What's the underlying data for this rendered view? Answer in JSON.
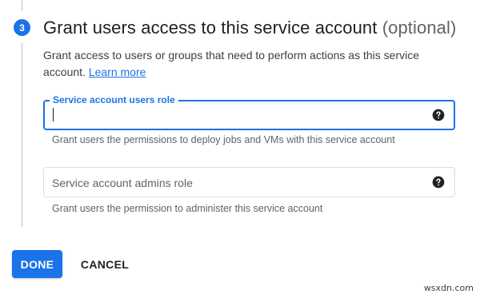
{
  "step": {
    "number": "3",
    "title": "Grant users access to this service account",
    "title_suffix": "(optional)",
    "description": "Grant access to users or groups that need to perform actions as this service account.",
    "learn_more": "Learn more"
  },
  "fields": {
    "users_role": {
      "label": "Service account users role",
      "value": "",
      "hint": "Grant users the permissions to deploy jobs and VMs with this service account",
      "help_icon": "help-circle-icon"
    },
    "admins_role": {
      "label": "Service account admins role",
      "value": "",
      "hint": "Grant users the permission to administer this service account",
      "help_icon": "help-circle-icon"
    }
  },
  "actions": {
    "done_label": "DONE",
    "cancel_label": "CANCEL"
  },
  "watermark": "wsxdn.com",
  "colors": {
    "accent": "#1a73e8",
    "text_primary": "#202124",
    "text_secondary": "#5f6368",
    "border": "#dadce0"
  }
}
